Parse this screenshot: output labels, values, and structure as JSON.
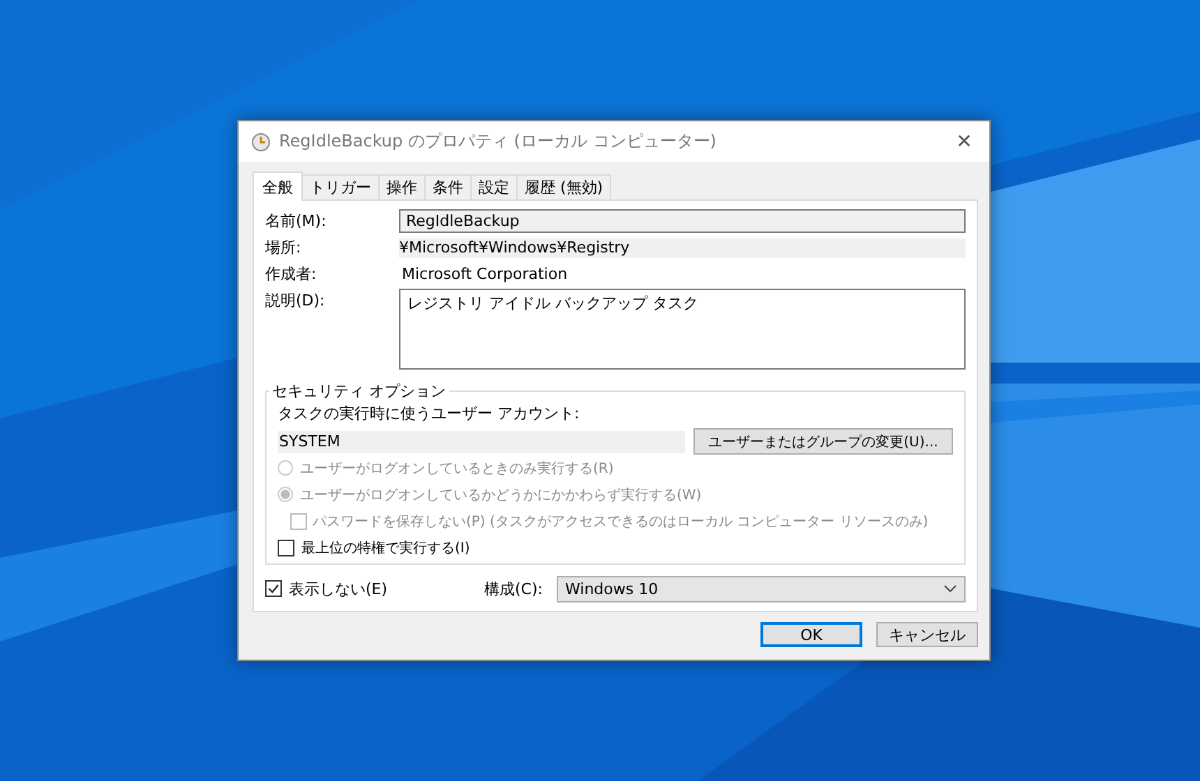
{
  "window": {
    "title": "RegIdleBackup のプロパティ (ローカル コンピューター)",
    "close": "✕"
  },
  "tabs": [
    {
      "label": "全般",
      "selected": true
    },
    {
      "label": "トリガー",
      "selected": false
    },
    {
      "label": "操作",
      "selected": false
    },
    {
      "label": "条件",
      "selected": false
    },
    {
      "label": "設定",
      "selected": false
    },
    {
      "label": "履歴 (無効)",
      "selected": false
    }
  ],
  "fields": [
    {
      "kind": "input",
      "label": "名前(M):",
      "value": "RegIdleBackup"
    },
    {
      "kind": "readonly",
      "label": "場所:",
      "value": "¥Microsoft¥Windows¥Registry"
    },
    {
      "kind": "text",
      "label": "作成者:",
      "value": "Microsoft Corporation"
    },
    {
      "kind": "textarea",
      "label": "説明(D):",
      "value": "レジストリ アイドル バックアップ タスク"
    }
  ],
  "security": {
    "title": "セキュリティ オプション",
    "account_label": "タスクの実行時に使うユーザー アカウント:",
    "account": "SYSTEM",
    "change_button": "ユーザーまたはグループの変更(U)...",
    "options": [
      {
        "kind": "radio",
        "label": "ユーザーがログオンしているときのみ実行する(R)",
        "selected": false,
        "disabled": true,
        "indented": false
      },
      {
        "kind": "radio",
        "label": "ユーザーがログオンしているかどうかにかかわらず実行する(W)",
        "selected": true,
        "disabled": true,
        "indented": false
      },
      {
        "kind": "checkbox",
        "label": "パスワードを保存しない(P) (タスクがアクセスできるのはローカル コンピューター リソースのみ)",
        "checked": false,
        "disabled": true,
        "indented": true
      },
      {
        "kind": "checkbox",
        "label": "最上位の特権で実行する(I)",
        "checked": false,
        "disabled": false,
        "indented": false
      }
    ]
  },
  "hidden": {
    "label": "表示しない(E)",
    "checked": true
  },
  "config": {
    "label": "構成(C):",
    "value": "Windows 10"
  },
  "buttons": [
    {
      "label": "OK",
      "default": true
    },
    {
      "label": "キャンセル",
      "default": false
    }
  ]
}
